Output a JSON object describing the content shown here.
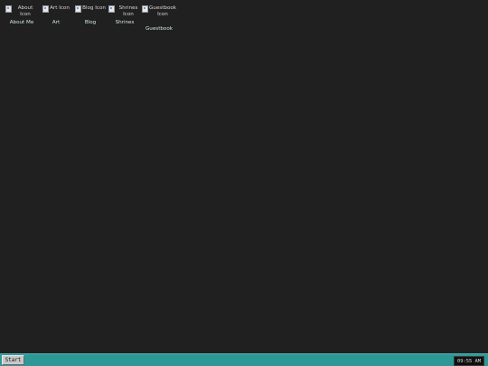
{
  "desktop": {
    "icons": [
      {
        "name": "about",
        "alt": "About Icon",
        "label": "About Me"
      },
      {
        "name": "art",
        "alt": "Art Icon",
        "label": "Art"
      },
      {
        "name": "blog",
        "alt": "Blog Icon",
        "label": "Blog"
      },
      {
        "name": "shrines",
        "alt": "Shrines Icon",
        "label": "Shrines"
      },
      {
        "name": "guestbook",
        "alt": "Guestbook Icon",
        "label": "Guestbook"
      }
    ]
  },
  "taskbar": {
    "start_label": "Start",
    "clock": "09:55 AM"
  },
  "colors": {
    "desktop_bg": "#202020",
    "taskbar_bg": "#2e9896"
  }
}
